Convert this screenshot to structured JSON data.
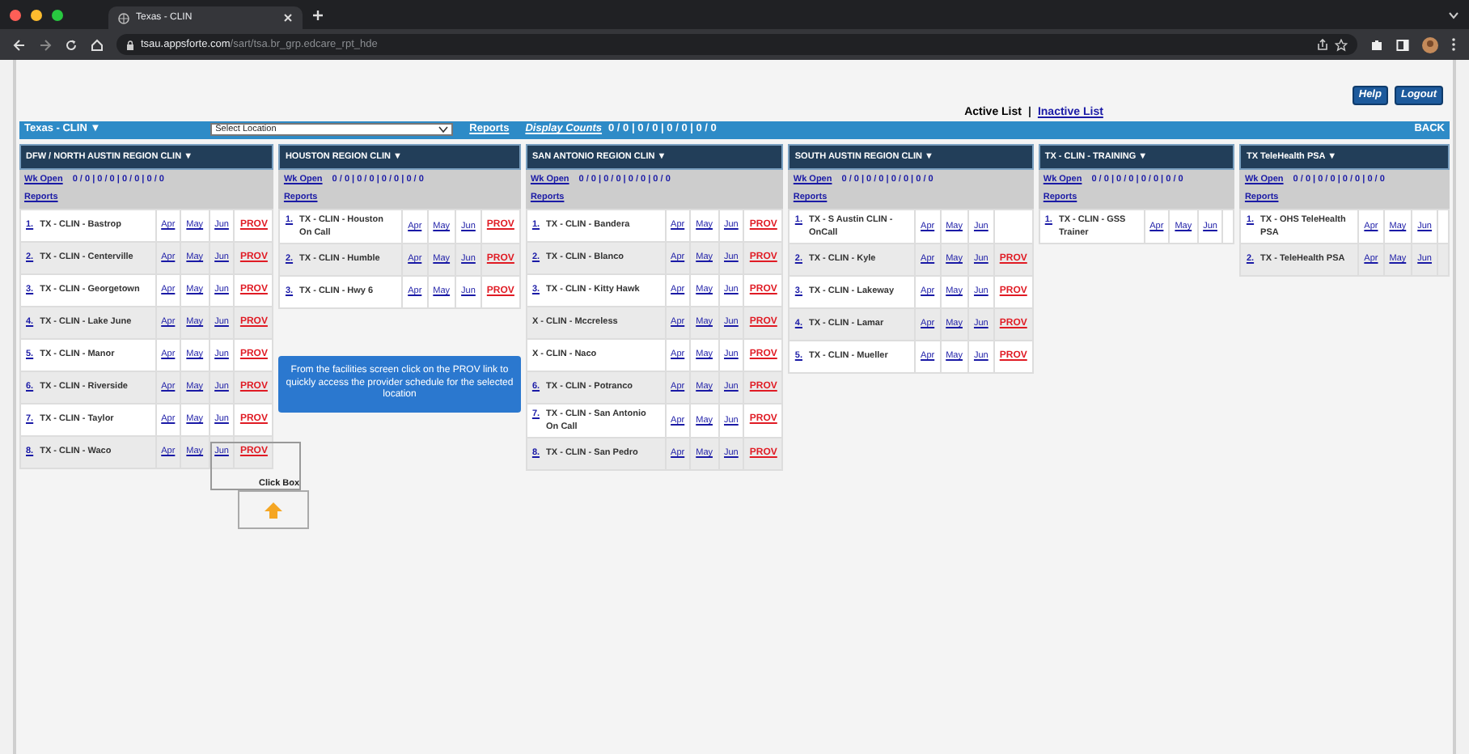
{
  "browser": {
    "tab_title": "Texas - CLIN",
    "url_host": "tsau.appsforte.com",
    "url_path": "/sart/tsa.br_grp.edcare_rpt_hde"
  },
  "header_buttons": [
    "Help",
    "Logout"
  ],
  "list_links": [
    {
      "label": "Active List",
      "selected": true
    },
    {
      "label": "Inactive List",
      "selected": false
    }
  ],
  "list_separator": "|",
  "toolbar": {
    "title": "Texas - CLIN ▼",
    "location_select": {
      "value": "Select Location"
    },
    "reports": "Reports",
    "display_counts_label": "Display Counts",
    "display_counts": "0 / 0 | 0 / 0 | 0 / 0 | 0 / 0",
    "back": "BACK"
  },
  "regions": [
    {
      "title": "DFW / NORTH AUSTIN REGION CLIN ▼",
      "wk_open": "Wk Open",
      "counts": "0 / 0 | 0 / 0 | 0 / 0 | 0 / 0",
      "reports": "Reports",
      "rows": [
        {
          "num": "1.",
          "name": "TX - CLIN - Bastrop",
          "months": [
            "Apr",
            "May",
            "Jun"
          ],
          "prov": "PROV"
        },
        {
          "num": "2.",
          "name": "TX - CLIN - Centerville",
          "months": [
            "Apr",
            "May",
            "Jun"
          ],
          "prov": "PROV"
        },
        {
          "num": "3.",
          "name": "TX - CLIN - Georgetown",
          "months": [
            "Apr",
            "May",
            "Jun"
          ],
          "prov": "PROV"
        },
        {
          "num": "4.",
          "name": "TX - CLIN - Lake June",
          "months": [
            "Apr",
            "May",
            "Jun"
          ],
          "prov": "PROV"
        },
        {
          "num": "5.",
          "name": "TX - CLIN - Manor",
          "months": [
            "Apr",
            "May",
            "Jun"
          ],
          "prov": "PROV"
        },
        {
          "num": "6.",
          "name": "TX - CLIN - Riverside",
          "months": [
            "Apr",
            "May",
            "Jun"
          ],
          "prov": "PROV"
        },
        {
          "num": "7.",
          "name": "TX - CLIN - Taylor",
          "months": [
            "Apr",
            "May",
            "Jun"
          ],
          "prov": "PROV"
        },
        {
          "num": "8.",
          "name": "TX - CLIN - Waco",
          "months": [
            "Apr",
            "May",
            "Jun"
          ],
          "prov": "PROV"
        }
      ]
    },
    {
      "title": "HOUSTON REGION CLIN ▼",
      "wk_open": "Wk Open",
      "counts": "0 / 0 | 0 / 0 | 0 / 0 | 0 / 0",
      "reports": "Reports",
      "rows": [
        {
          "num": "1.",
          "name": "TX - CLIN - Houston On Call",
          "months": [
            "Apr",
            "May",
            "Jun"
          ],
          "prov": "PROV"
        },
        {
          "num": "2.",
          "name": "TX - CLIN - Humble",
          "months": [
            "Apr",
            "May",
            "Jun"
          ],
          "prov": "PROV"
        },
        {
          "num": "3.",
          "name": "TX - CLIN - Hwy 6",
          "months": [
            "Apr",
            "May",
            "Jun"
          ],
          "prov": "PROV"
        }
      ]
    },
    {
      "title": "SAN ANTONIO REGION CLIN ▼",
      "wk_open": "Wk Open",
      "counts": "0 / 0 | 0 / 0 | 0 / 0 | 0 / 0",
      "reports": "Reports",
      "rows": [
        {
          "num": "1.",
          "name": "TX - CLIN - Bandera",
          "months": [
            "Apr",
            "May",
            "Jun"
          ],
          "prov": "PROV"
        },
        {
          "num": "2.",
          "name": "TX - CLIN - Blanco",
          "months": [
            "Apr",
            "May",
            "Jun"
          ],
          "prov": "PROV"
        },
        {
          "num": "3.",
          "name": "TX - CLIN - Kitty Hawk",
          "months": [
            "Apr",
            "May",
            "Jun"
          ],
          "prov": "PROV"
        },
        {
          "name": "X - CLIN - Mccreless",
          "months": [
            "Apr",
            "May",
            "Jun"
          ],
          "prov": "PROV"
        },
        {
          "name": "X - CLIN - Naco",
          "months": [
            "Apr",
            "May",
            "Jun"
          ],
          "prov": "PROV"
        },
        {
          "num": "6.",
          "name": "TX - CLIN - Potranco",
          "months": [
            "Apr",
            "May",
            "Jun"
          ],
          "prov": "PROV"
        },
        {
          "num": "7.",
          "name": "TX - CLIN - San Antonio On Call",
          "months": [
            "Apr",
            "May",
            "Jun"
          ],
          "prov": "PROV"
        },
        {
          "num": "8.",
          "name": "TX - CLIN - San Pedro",
          "months": [
            "Apr",
            "May",
            "Jun"
          ],
          "prov": "PROV"
        }
      ]
    },
    {
      "title": "SOUTH AUSTIN REGION CLIN ▼",
      "wk_open": "Wk Open",
      "counts": "0 / 0 | 0 / 0 | 0 / 0 | 0 / 0",
      "reports": "Reports",
      "rows": [
        {
          "num": "1.",
          "name": "TX - S Austin CLIN - OnCall",
          "months": [
            "Apr",
            "May",
            "Jun"
          ]
        },
        {
          "num": "2.",
          "name": "TX - CLIN - Kyle",
          "months": [
            "Apr",
            "May",
            "Jun"
          ],
          "prov": "PROV"
        },
        {
          "num": "3.",
          "name": "TX - CLIN - Lakeway",
          "months": [
            "Apr",
            "May",
            "Jun"
          ],
          "prov": "PROV"
        },
        {
          "num": "4.",
          "name": "TX - CLIN - Lamar",
          "months": [
            "Apr",
            "May",
            "Jun"
          ],
          "prov": "PROV"
        },
        {
          "num": "5.",
          "name": "TX - CLIN - Mueller",
          "months": [
            "Apr",
            "May",
            "Jun"
          ],
          "prov": "PROV"
        }
      ]
    },
    {
      "title": "TX - CLIN - TRAINING ▼",
      "wk_open": "Wk Open",
      "counts": "0 / 0 | 0 / 0 | 0 / 0 | 0 / 0",
      "reports": "Reports",
      "rows": [
        {
          "num": "1.",
          "name": "TX - CLIN - GSS Trainer",
          "months": [
            "Apr",
            "May",
            "Jun"
          ]
        }
      ]
    },
    {
      "title": "TX TeleHealth PSA ▼",
      "wk_open": "Wk Open",
      "counts": "0 / 0 | 0 / 0 | 0 / 0 | 0 / 0",
      "reports": "Reports",
      "rows": [
        {
          "num": "1.",
          "name": "TX - OHS TeleHealth PSA",
          "months": [
            "Apr",
            "May",
            "Jun"
          ]
        },
        {
          "num": "2.",
          "name": "TX - TeleHealth PSA",
          "months": [
            "Apr",
            "May",
            "Jun"
          ]
        }
      ]
    }
  ],
  "tooltip": {
    "text": "From the facilities screen click on the PROV link to quickly access the provider schedule for the selected location"
  },
  "click_box": {
    "label": "Click Box"
  }
}
